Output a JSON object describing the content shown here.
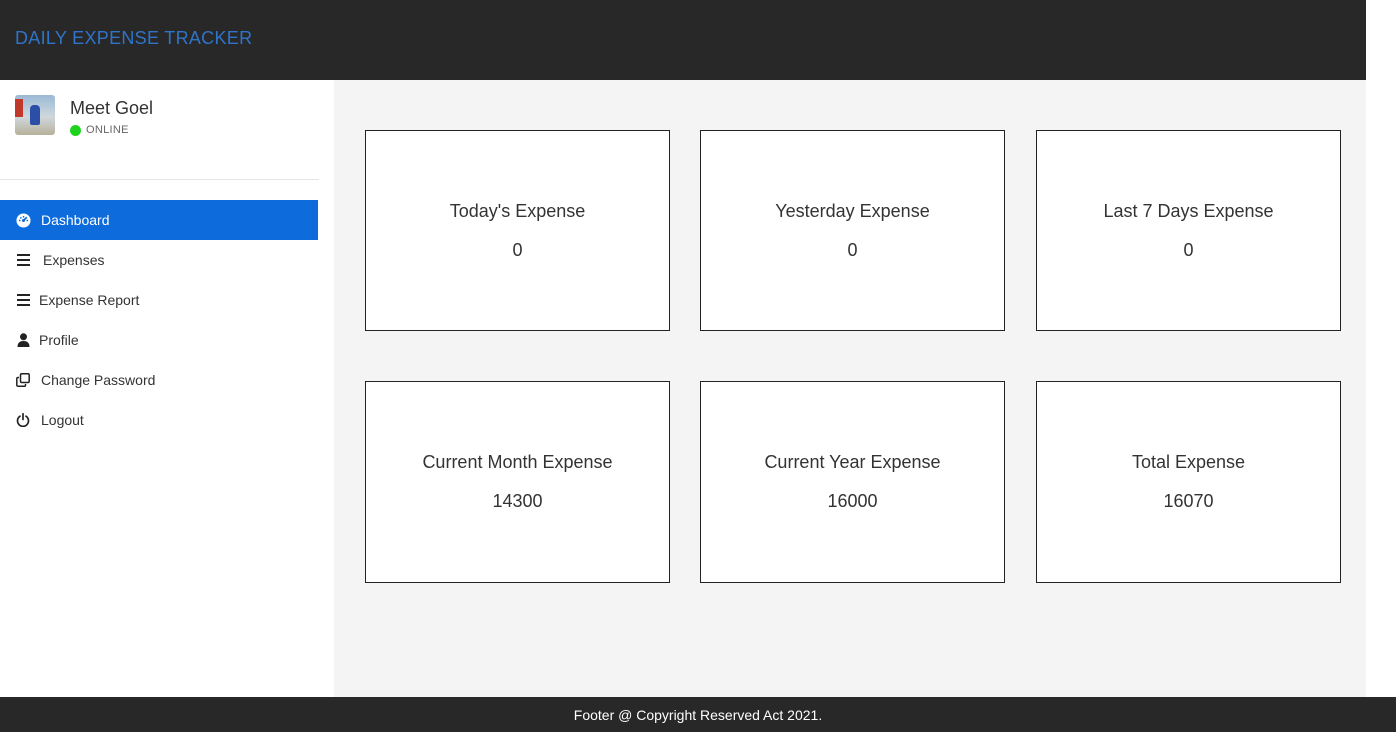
{
  "header": {
    "title": "DAILY EXPENSE TRACKER"
  },
  "user": {
    "name": "Meet Goel",
    "status": "ONLINE"
  },
  "sidebar": {
    "items": [
      {
        "label": "Dashboard",
        "icon": "dashboard-icon",
        "active": true
      },
      {
        "label": "Expenses",
        "icon": "list-icon",
        "active": false
      },
      {
        "label": "Expense Report",
        "icon": "list-icon",
        "active": false
      },
      {
        "label": "Profile",
        "icon": "user-icon",
        "active": false
      },
      {
        "label": "Change Password",
        "icon": "copy-icon",
        "active": false
      },
      {
        "label": "Logout",
        "icon": "power-icon",
        "active": false
      }
    ]
  },
  "cards": [
    {
      "title": "Today's Expense",
      "value": "0"
    },
    {
      "title": "Yesterday Expense",
      "value": "0"
    },
    {
      "title": "Last 7 Days Expense",
      "value": "0"
    },
    {
      "title": "Current Month Expense",
      "value": "14300"
    },
    {
      "title": "Current Year Expense",
      "value": "16000"
    },
    {
      "title": "Total Expense",
      "value": "16070"
    }
  ],
  "footer": {
    "text": "Footer @ Copyright Reserved Act 2021."
  },
  "colors": {
    "header_bg": "#282828",
    "title": "#2f74c9",
    "active_nav": "#0d6bdc",
    "online": "#1ed31e",
    "main_bg": "#f4f4f4"
  }
}
